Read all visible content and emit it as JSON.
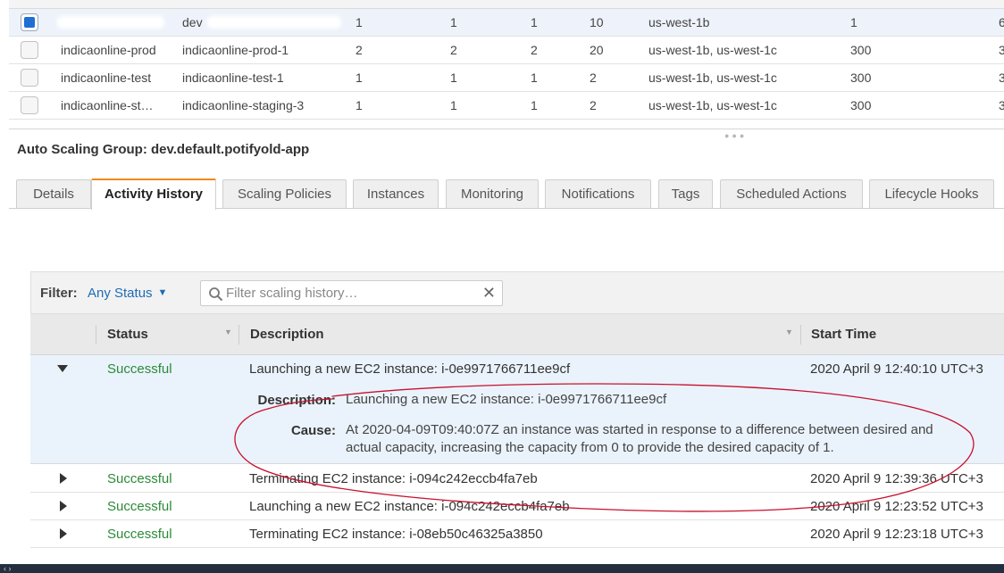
{
  "asg_table": {
    "rows": [
      {
        "name": "",
        "launch_config": "dev",
        "instances": "1",
        "desired": "1",
        "min": "1",
        "max": "10",
        "azs": "us-west-1b",
        "cooldown": "1",
        "last": "6",
        "selected": true
      },
      {
        "name": "indicaonline-prod",
        "launch_config": "indicaonline-prod-1",
        "instances": "2",
        "desired": "2",
        "min": "2",
        "max": "20",
        "azs": "us-west-1b, us-west-1c",
        "cooldown": "300",
        "last": "3",
        "selected": false
      },
      {
        "name": "indicaonline-test",
        "launch_config": "indicaonline-test-1",
        "instances": "1",
        "desired": "1",
        "min": "1",
        "max": "2",
        "azs": "us-west-1b, us-west-1c",
        "cooldown": "300",
        "last": "3",
        "selected": false
      },
      {
        "name": "indicaonline-st…",
        "launch_config": "indicaonline-staging-3",
        "instances": "1",
        "desired": "1",
        "min": "1",
        "max": "2",
        "azs": "us-west-1b, us-west-1c",
        "cooldown": "300",
        "last": "3",
        "selected": false
      }
    ]
  },
  "asg_title": "Auto Scaling Group: dev.default.potifyold-app",
  "tabs": [
    {
      "label": "Details"
    },
    {
      "label": "Activity History",
      "active": true
    },
    {
      "label": "Scaling Policies"
    },
    {
      "label": "Instances"
    },
    {
      "label": "Monitoring"
    },
    {
      "label": "Notifications"
    },
    {
      "label": "Tags"
    },
    {
      "label": "Scheduled Actions"
    },
    {
      "label": "Lifecycle Hooks"
    }
  ],
  "filter": {
    "label": "Filter:",
    "status_value": "Any Status",
    "search_placeholder": "Filter scaling history…",
    "clear_glyph": "✕"
  },
  "history": {
    "columns": {
      "status": "Status",
      "description": "Description",
      "start_time": "Start Time"
    },
    "rows": [
      {
        "status": "Successful",
        "description": "Launching a new EC2 instance: i-0e9971766711ee9cf",
        "start_time": "2020 April 9 12:40:10 UTC+3",
        "expanded": true
      },
      {
        "status": "Successful",
        "description": "Terminating EC2 instance: i-094c242eccb4fa7eb",
        "start_time": "2020 April 9 12:39:36 UTC+3",
        "expanded": false
      },
      {
        "status": "Successful",
        "description": "Launching a new EC2 instance: i-094c242eccb4fa7eb",
        "start_time": "2020 April 9 12:23:52 UTC+3",
        "expanded": false
      },
      {
        "status": "Successful",
        "description": "Terminating EC2 instance: i-08eb50c46325a3850",
        "start_time": "2020 April 9 12:23:18 UTC+3",
        "expanded": false
      }
    ],
    "detail": {
      "description_label": "Description:",
      "description_value": "Launching a new EC2 instance: i-0e9971766711ee9cf",
      "cause_label": "Cause:",
      "cause_value": "At 2020-04-09T09:40:07Z an instance was started in response to a difference between desired and actual capacity, increasing the capacity from 0 to provide the desired capacity of 1."
    }
  },
  "colors": {
    "accent_tab": "#ec8a1c",
    "link": "#1f6bb4",
    "success": "#2c8a3a",
    "annotation": "#c8102e",
    "footer": "#232f3e"
  }
}
